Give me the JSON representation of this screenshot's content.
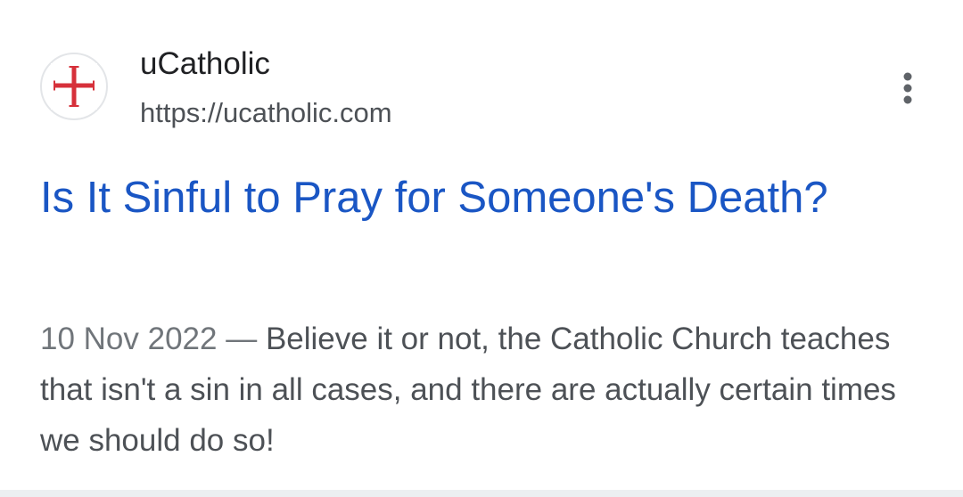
{
  "result": {
    "site_name": "uCatholic",
    "site_url": "https://ucatholic.com",
    "favicon_icon": "red-cross-icon",
    "title": "Is It Sinful to Pray for Someone's Death?",
    "date": "10 Nov 2022",
    "separator": " — ",
    "snippet": "Believe it or not, the Catholic Church teaches that isn't a sin in all cases, and there are actually certain times we should do so!",
    "menu_icon": "more-vert-icon"
  },
  "colors": {
    "title_link": "#1a56c4",
    "site_name": "#202124",
    "url": "#4d5156",
    "snippet": "#4d5156",
    "favicon_cross": "#d6303a"
  }
}
